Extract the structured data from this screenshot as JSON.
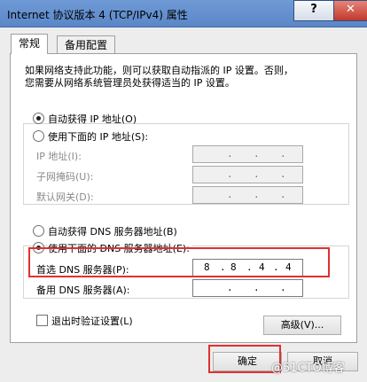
{
  "window": {
    "title": "Internet 协议版本 4 (TCP/IPv4) 属性",
    "help_label": "?",
    "close_label": "✕"
  },
  "tabs": [
    {
      "label": "常规"
    },
    {
      "label": "备用配置"
    }
  ],
  "description": {
    "line1": "如果网络支持此功能，则可以获取自动指派的 IP 设置。否则，",
    "line2": "您需要从网络系统管理员处获得适当的 IP 设置。"
  },
  "ip_section": {
    "auto_label": "自动获得 IP 地址(O)",
    "manual_label": "使用下面的 IP 地址(S):",
    "selected": "auto",
    "fields": [
      {
        "label": "IP 地址(I):",
        "value": [
          "",
          "",
          "",
          ""
        ]
      },
      {
        "label": "子网掩码(U):",
        "value": [
          "",
          "",
          "",
          ""
        ]
      },
      {
        "label": "默认网关(D):",
        "value": [
          "",
          "",
          "",
          ""
        ]
      }
    ]
  },
  "dns_section": {
    "auto_label": "自动获得 DNS 服务器地址(B)",
    "manual_label": "使用下面的 DNS 服务器地址(E):",
    "selected": "manual",
    "preferred": {
      "label": "首选 DNS 服务器(P):",
      "octets": [
        "8",
        "8",
        "4",
        "4"
      ]
    },
    "alternate": {
      "label": "备用 DNS 服务器(A):",
      "octets": [
        "",
        "",
        "",
        ""
      ]
    }
  },
  "validate": {
    "label": "退出时验证设置(L)",
    "checked": false
  },
  "advanced_label": "高级(V)...",
  "ok_label": "确定",
  "cancel_label": "取消",
  "watermark": "@51CTO博客",
  "colors": {
    "highlight_box": "#e03030",
    "title_bar": "#5b87c8"
  }
}
